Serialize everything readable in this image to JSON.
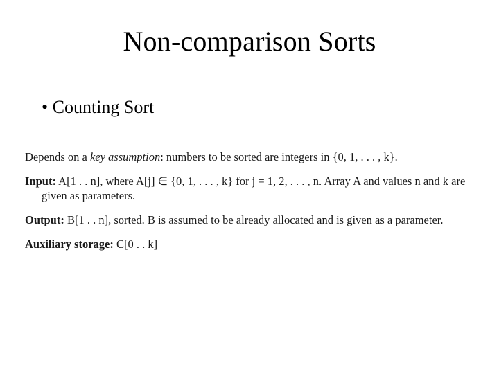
{
  "title": "Non-comparison Sorts",
  "bullets": [
    "Counting Sort"
  ],
  "defs": {
    "depends_pre": "Depends on a ",
    "depends_em": "key assumption",
    "depends_post": ": numbers to be sorted are integers in {0, 1, . . . , k}.",
    "input_label": "Input:",
    "input_body": " A[1 . . n], where A[j] ∈ {0, 1, . . . , k} for j = 1, 2, . . . , n. Array A and values n and k are given as parameters.",
    "output_label": "Output:",
    "output_body": " B[1 . . n], sorted. B is assumed to be already allocated and is given as a parameter.",
    "aux_label": "Auxiliary storage:",
    "aux_body": " C[0 . . k]"
  }
}
